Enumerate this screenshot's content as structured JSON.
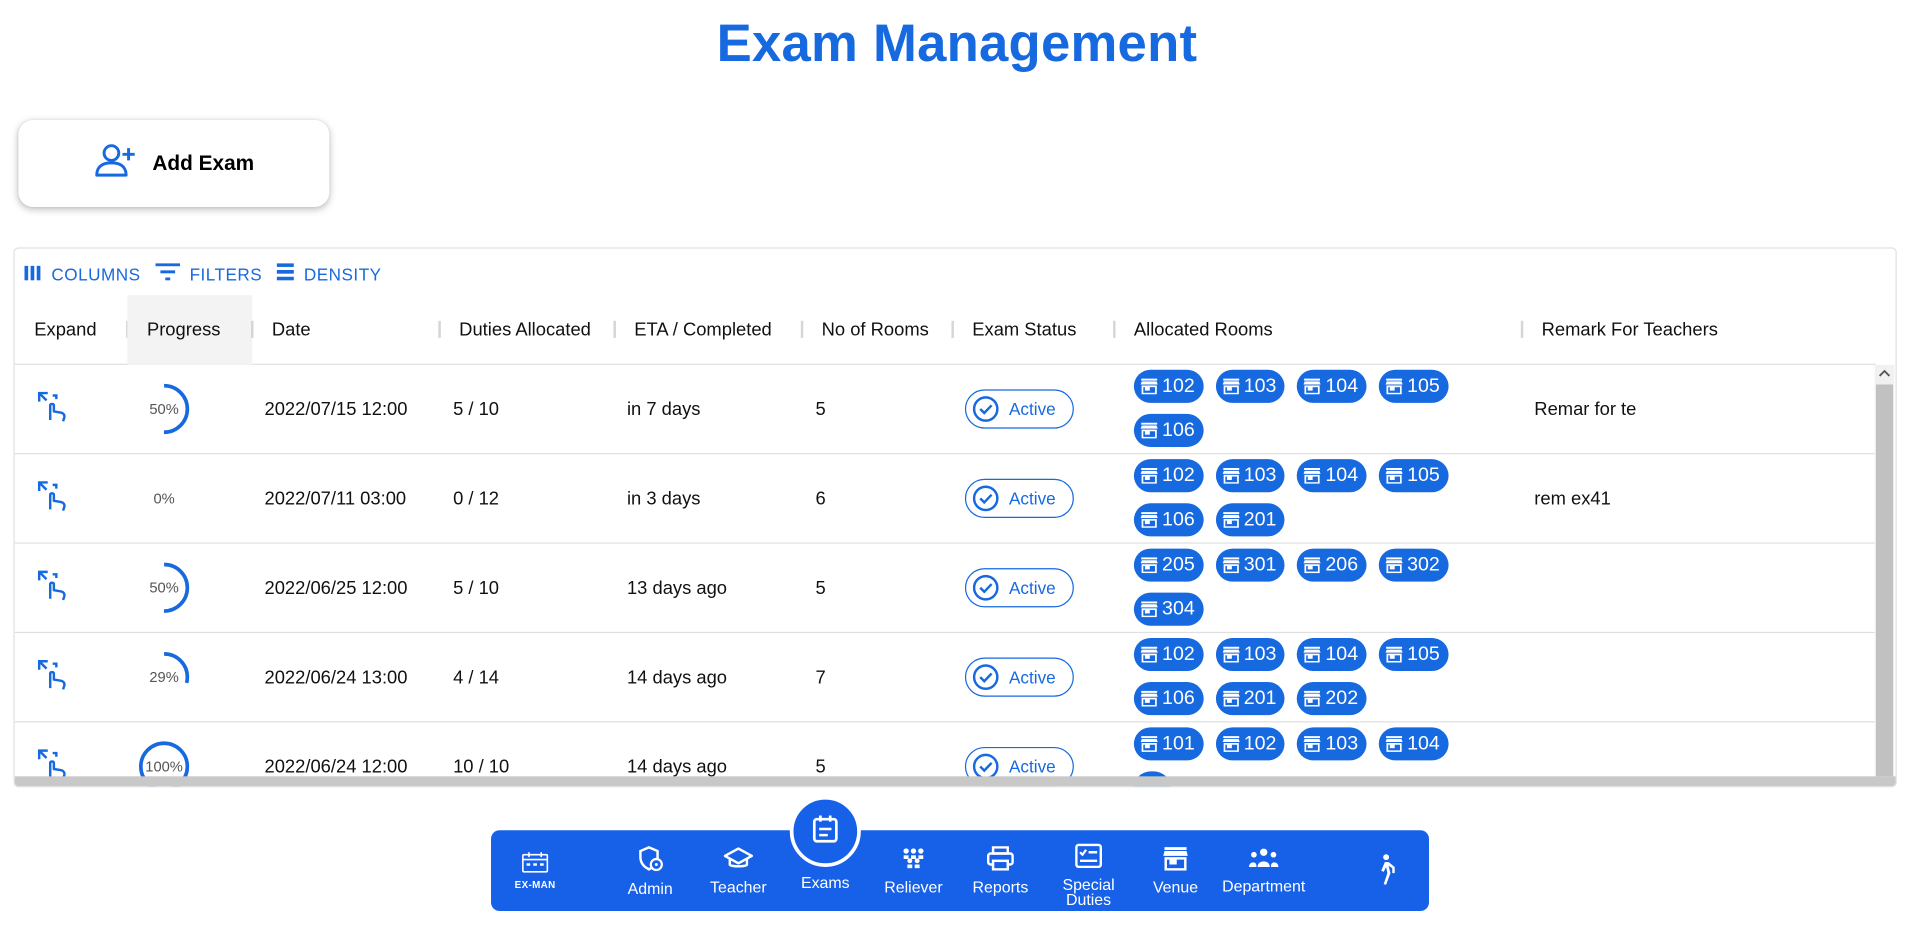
{
  "page": {
    "title": "Exam Management"
  },
  "add_button": {
    "label": "Add Exam"
  },
  "toolbar": {
    "columns": "COLUMNS",
    "filters": "FILTERS",
    "density": "DENSITY"
  },
  "columns": [
    "Expand",
    "Progress",
    "Date",
    "Duties Allocated",
    "ETA / Completed",
    "No of Rooms",
    "Exam Status",
    "Allocated Rooms",
    "Remark For Teachers"
  ],
  "rows": [
    {
      "progress": 50,
      "progress_label": "50%",
      "date": "2022/07/15 12:00",
      "duties": "5 / 10",
      "eta": "in 7 days",
      "rooms_count": "5",
      "status": "Active",
      "rooms": [
        "102",
        "103",
        "104",
        "105",
        "106"
      ],
      "remark": "Remar for te"
    },
    {
      "progress": 0,
      "progress_label": "0%",
      "date": "2022/07/11 03:00",
      "duties": "0 / 12",
      "eta": "in 3 days",
      "rooms_count": "6",
      "status": "Active",
      "rooms": [
        "102",
        "103",
        "104",
        "105",
        "106",
        "201"
      ],
      "remark": "rem ex41"
    },
    {
      "progress": 50,
      "progress_label": "50%",
      "date": "2022/06/25 12:00",
      "duties": "5 / 10",
      "eta": "13 days ago",
      "rooms_count": "5",
      "status": "Active",
      "rooms": [
        "205",
        "301",
        "206",
        "302",
        "304"
      ],
      "remark": ""
    },
    {
      "progress": 29,
      "progress_label": "29%",
      "date": "2022/06/24 13:00",
      "duties": "4 / 14",
      "eta": "14 days ago",
      "rooms_count": "7",
      "status": "Active",
      "rooms": [
        "102",
        "103",
        "104",
        "105",
        "106",
        "201",
        "202"
      ],
      "remark": ""
    },
    {
      "progress": 100,
      "progress_label": "100%",
      "date": "2022/06/24 12:00",
      "duties": "10 / 10",
      "eta": "14 days ago",
      "rooms_count": "5",
      "status": "Active",
      "rooms": [
        "101",
        "102",
        "103",
        "104",
        ""
      ],
      "remark": ""
    }
  ],
  "nav": {
    "logo": "EX-MAN",
    "items": [
      "Admin",
      "Teacher",
      "Exams",
      "Reliever",
      "Reports",
      "Special Duties",
      "Venue",
      "Department"
    ]
  },
  "colors": {
    "accent": "#1769e0",
    "navbar": "#1760e8"
  }
}
